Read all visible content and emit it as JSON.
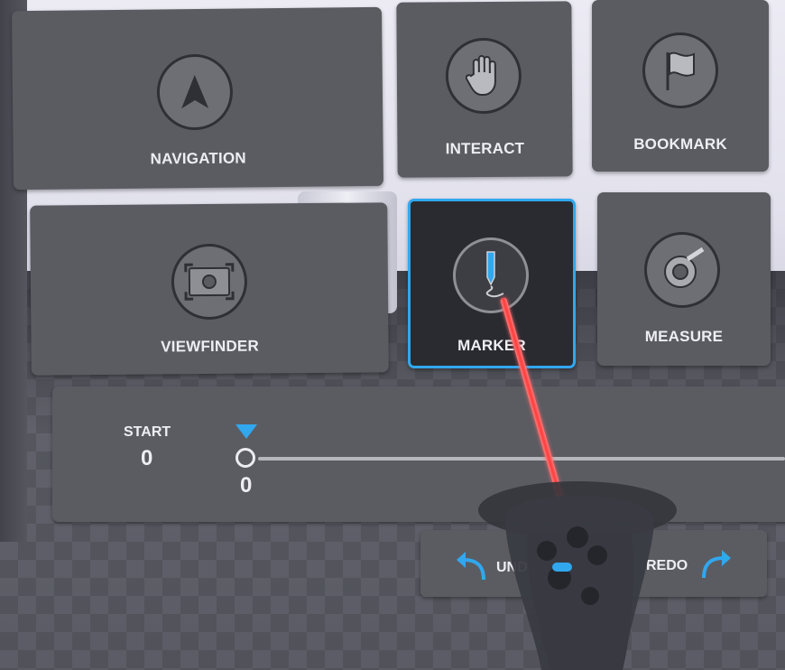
{
  "menu": {
    "tiles": [
      {
        "label": "NAVIGATION",
        "icon": "navigation-arrow-icon"
      },
      {
        "label": "INTERACT",
        "icon": "hand-icon"
      },
      {
        "label": "BOOKMARK",
        "icon": "flag-icon"
      },
      {
        "label": "VIEWFINDER",
        "icon": "camera-frame-icon"
      },
      {
        "label": "MARKER",
        "icon": "marker-pen-icon",
        "selected": true
      },
      {
        "label": "MEASURE",
        "icon": "tape-measure-icon"
      }
    ]
  },
  "timeline": {
    "start_label": "START",
    "start_value": "0",
    "current_value": "0",
    "playhead_color": "#31a7ee"
  },
  "history": {
    "undo_label": "UNDO",
    "redo_label": "REDO",
    "arrow_color": "#31a7ee"
  },
  "colors": {
    "accent": "#31a7ee",
    "tile": "#5b5c62",
    "tile_selected": "#2a2b30",
    "laser": "#ff3b3b"
  }
}
